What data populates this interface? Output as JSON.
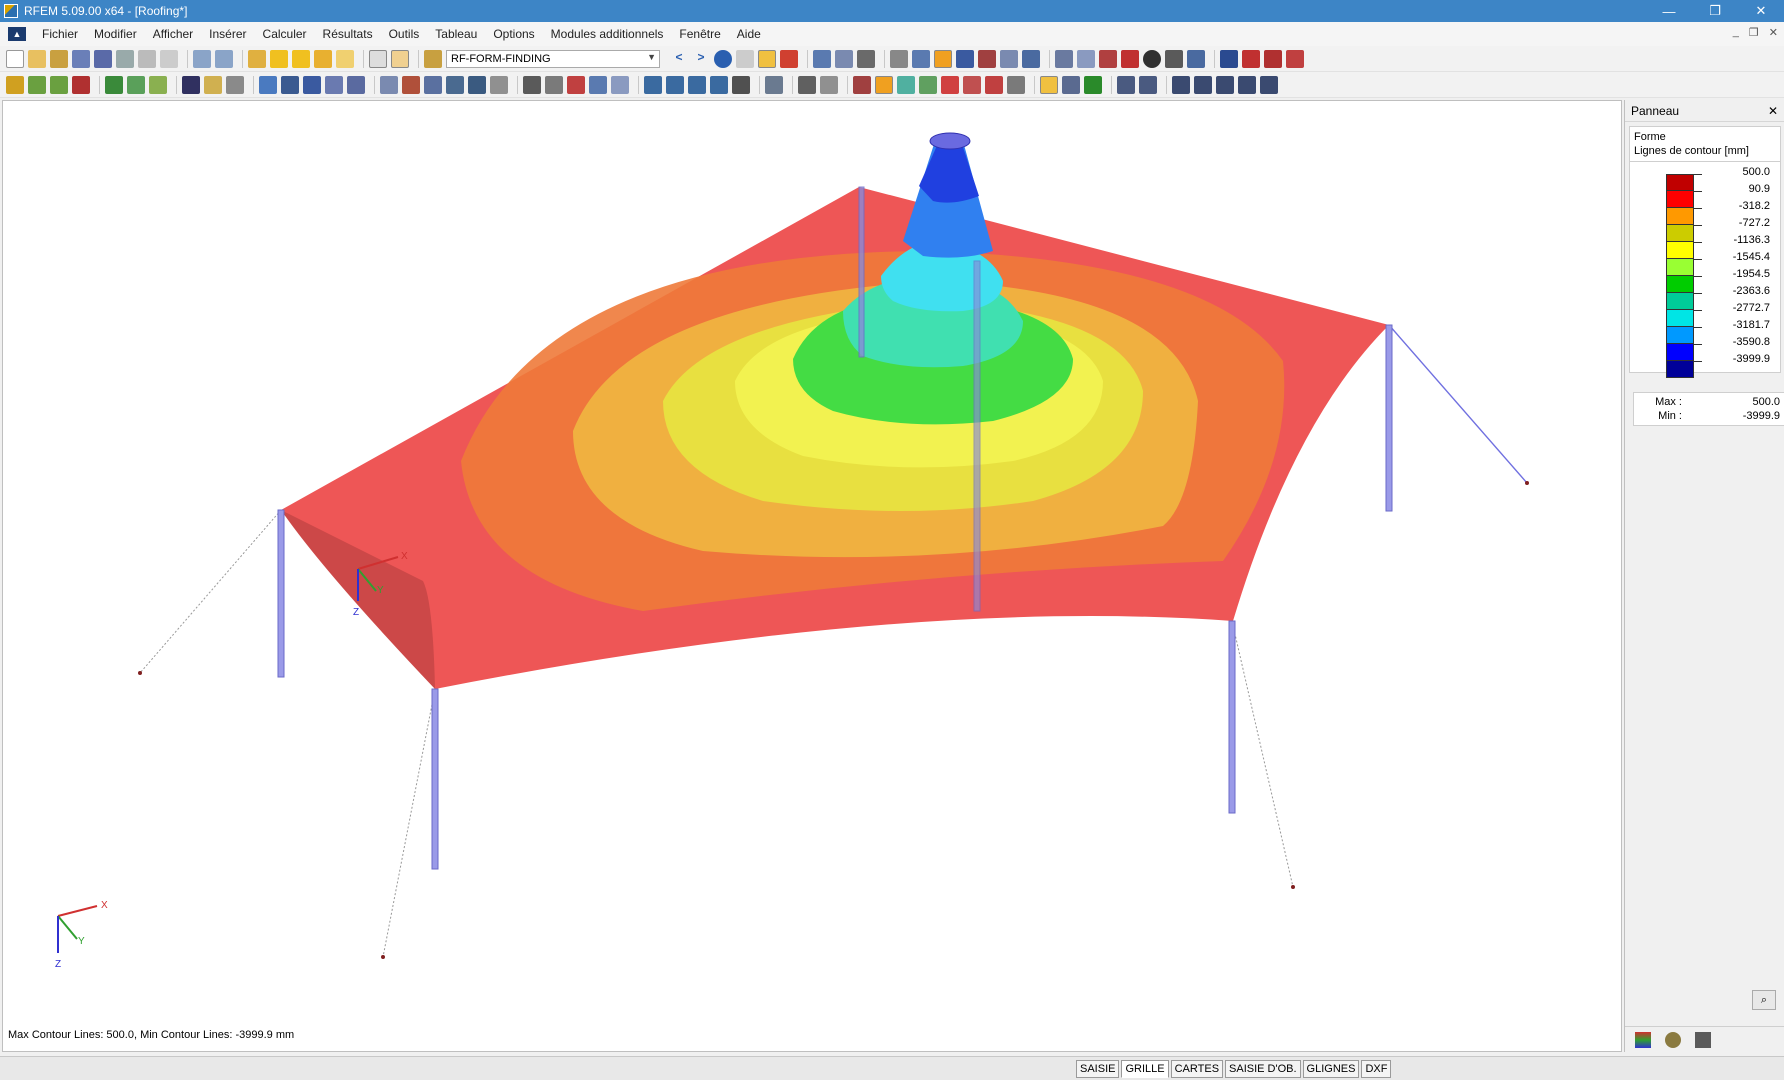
{
  "window": {
    "title": "RFEM 5.09.00 x64 - [Roofing*]",
    "controls": [
      "—",
      "❐",
      "✕"
    ]
  },
  "menu": {
    "items": [
      "Fichier",
      "Modifier",
      "Afficher",
      "Insérer",
      "Calculer",
      "Résultats",
      "Outils",
      "Tableau",
      "Options",
      "Modules additionnels",
      "Fenêtre",
      "Aide"
    ],
    "mdi_controls": [
      "_",
      "❐",
      "✕"
    ]
  },
  "toolbar": {
    "module_combo": "RF-FORM-FINDING"
  },
  "viewport": {
    "status_text": "Max Contour Lines: 500.0, Min Contour Lines: -3999.9 mm",
    "axis_labels": {
      "x": "X",
      "y": "Y",
      "z": "Z"
    }
  },
  "panel": {
    "header": "Panneau",
    "close": "✕",
    "title": "Forme",
    "subtitle": "Lignes de contour [mm]",
    "legend": [
      {
        "value": "500.0",
        "color": "#c00000"
      },
      {
        "value": "90.9",
        "color": "#ff0000"
      },
      {
        "value": "-318.2",
        "color": "#ff9900"
      },
      {
        "value": "-727.2",
        "color": "#cccc00"
      },
      {
        "value": "-1136.3",
        "color": "#ffff00"
      },
      {
        "value": "-1545.4",
        "color": "#99ff33"
      },
      {
        "value": "-1954.5",
        "color": "#00cc00"
      },
      {
        "value": "-2363.6",
        "color": "#00cc99"
      },
      {
        "value": "-2772.7",
        "color": "#00e5e5"
      },
      {
        "value": "-3181.7",
        "color": "#0099ff"
      },
      {
        "value": "-3590.8",
        "color": "#0000ff"
      },
      {
        "value": "-3999.9",
        "color": "#000099"
      }
    ],
    "max_label": "Max :",
    "max_value": "500.0",
    "min_label": "Min :",
    "min_value": "-3999.9"
  },
  "status_tabs": [
    "SAISIE",
    "GRILLE",
    "CARTES",
    "SAISIE D'OB.",
    "GLIGNES",
    "DXF"
  ]
}
